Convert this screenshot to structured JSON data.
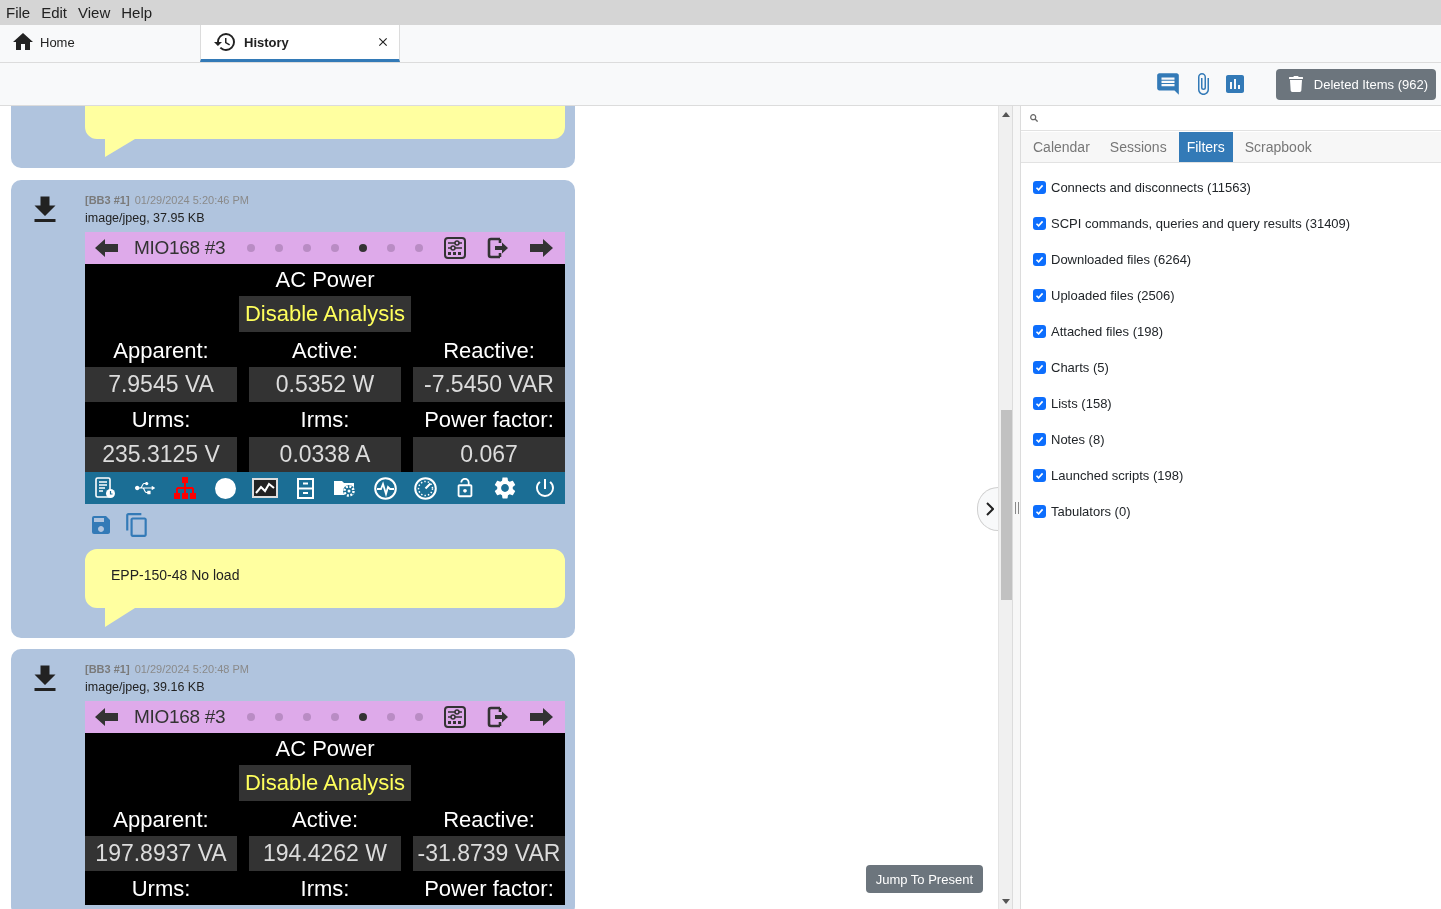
{
  "menu": [
    "File",
    "Edit",
    "View",
    "Help"
  ],
  "tabs": [
    {
      "kind": "home",
      "label": "Home",
      "selected": false,
      "closable": false
    },
    {
      "kind": "history",
      "label": "History",
      "selected": true,
      "closable": true
    }
  ],
  "toolbar": {
    "deleted_items": "Deleted Items (962)"
  },
  "history": {
    "entries": [
      {
        "kind": "fragment"
      },
      {
        "kind": "file",
        "cut_off": false,
        "source": "[BB3 #1]",
        "time": "01/29/2024 5:20:46 PM",
        "info": "image/jpeg, 37.95 KB",
        "screen": {
          "device": "MIO168 #3",
          "dots": [
            {
              "selected": false
            },
            {
              "selected": false
            },
            {
              "selected": false
            },
            {
              "selected": false
            },
            {
              "selected": true
            },
            {
              "selected": false
            },
            {
              "selected": false
            }
          ],
          "title": "AC Power",
          "button": "Disable Analysis",
          "rows": [
            {
              "cells": [
                {
                  "label": "Apparent:",
                  "value": "7.9545 VA"
                },
                {
                  "label": "Active:",
                  "value": "0.5352 W"
                },
                {
                  "label": "Reactive:",
                  "value": "-7.5450 VAR"
                }
              ]
            },
            {
              "cells": [
                {
                  "label": "Urms:",
                  "value": "235.3125 V"
                },
                {
                  "label": "Irms:",
                  "value": "0.0338 A"
                },
                {
                  "label": "Power factor:",
                  "value": "0.067"
                }
              ]
            }
          ]
        },
        "note": "EPP-150-48 No load"
      },
      {
        "kind": "file",
        "cut_off": true,
        "source": "[BB3 #1]",
        "time": "01/29/2024 5:20:48 PM",
        "info": "image/jpeg, 39.16 KB",
        "screen": {
          "device": "MIO168 #3",
          "dots": [
            {
              "selected": false
            },
            {
              "selected": false
            },
            {
              "selected": false
            },
            {
              "selected": false
            },
            {
              "selected": true
            },
            {
              "selected": false
            },
            {
              "selected": false
            }
          ],
          "title": "AC Power",
          "button": "Disable Analysis",
          "rows": [
            {
              "cells": [
                {
                  "label": "Apparent:",
                  "value": "197.8937 VA"
                },
                {
                  "label": "Active:",
                  "value": "194.4262 W"
                },
                {
                  "label": "Reactive:",
                  "value": "-31.8739 VAR"
                }
              ]
            },
            {
              "cells": [
                {
                  "label": "Urms:"
                },
                {
                  "label": "Irms:"
                },
                {
                  "label": "Power factor:"
                }
              ]
            }
          ]
        }
      }
    ],
    "jump_button": "Jump To Present"
  },
  "side_panel": {
    "tabs": [
      {
        "label": "Calendar",
        "selected": false
      },
      {
        "label": "Sessions",
        "selected": false
      },
      {
        "label": "Filters",
        "selected": true
      },
      {
        "label": "Scrapbook",
        "selected": false
      }
    ],
    "filters": [
      {
        "label": "Connects and disconnects (11563)",
        "checked": true
      },
      {
        "label": "SCPI commands, queries and query results (31409)",
        "checked": true
      },
      {
        "label": "Downloaded files (6264)",
        "checked": true
      },
      {
        "label": "Uploaded files (2506)",
        "checked": true
      },
      {
        "label": "Attached files (198)",
        "checked": true
      },
      {
        "label": "Charts (5)",
        "checked": true
      },
      {
        "label": "Lists (158)",
        "checked": true
      },
      {
        "label": "Notes (8)",
        "checked": true
      },
      {
        "label": "Launched scripts (198)",
        "checked": true
      },
      {
        "label": "Tabulators (0)",
        "checked": true
      }
    ]
  }
}
